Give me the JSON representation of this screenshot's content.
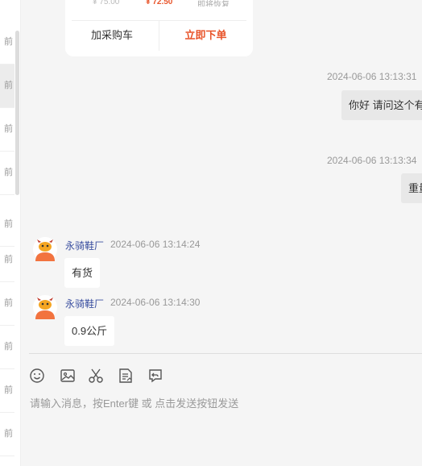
{
  "session_list": {
    "items": [
      {
        "time_label": "前"
      },
      {
        "time_label": "前"
      },
      {
        "time_label": "前"
      },
      {
        "time_label": "前"
      },
      {
        "time_label": "前"
      },
      {
        "time_label": "前"
      },
      {
        "time_label": "前"
      },
      {
        "time_label": "前"
      },
      {
        "time_label": "前"
      },
      {
        "time_label": "前"
      }
    ]
  },
  "product_card": {
    "original_price": "¥ 75.00",
    "current_price": "¥ 72.50",
    "note": "即将恢复",
    "add_to_cart_label": "加采购车",
    "order_now_label": "立即下单"
  },
  "messages": [
    {
      "side": "right",
      "timestamp": "2024-06-06 13:13:31",
      "text": "你好 请问这个有"
    },
    {
      "side": "right",
      "timestamp": "2024-06-06 13:13:34",
      "text": "重量"
    },
    {
      "side": "left",
      "sender": "永骑鞋厂",
      "timestamp": "2024-06-06 13:14:24",
      "text": "有货"
    },
    {
      "side": "left",
      "sender": "永骑鞋厂",
      "timestamp": "2024-06-06 13:14:30",
      "text": "0.9公斤"
    }
  ],
  "input": {
    "placeholder": "请输入消息，按Enter键 或 点击发送按钮发送"
  },
  "toolbar": {
    "icons": [
      "emoji-icon",
      "image-icon",
      "scissors-icon",
      "order-icon",
      "undo-icon"
    ]
  },
  "colors": {
    "accent": "#e8542a",
    "sender_name": "#3a4fa0",
    "avatar": "#f2733f"
  }
}
